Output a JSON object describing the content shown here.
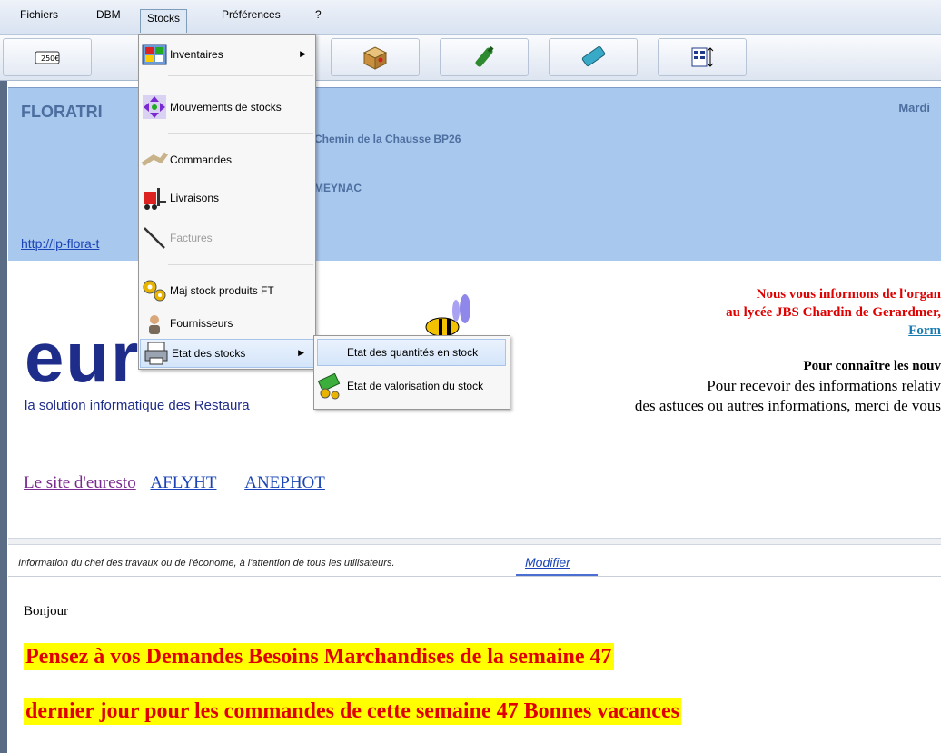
{
  "menubar": {
    "items": [
      "Fichiers",
      "DBM",
      "Stocks",
      "Préférences",
      "?"
    ]
  },
  "toolbar": {
    "buttons": [
      "price-tag-icon",
      "inventory-icon",
      "box-icon",
      "bottle-icon",
      "keyboard-icon",
      "columns-icon"
    ]
  },
  "header": {
    "school": "FLORATRI",
    "address1": "Chemin de la Chausse BP26",
    "city": "MEYNAC",
    "date": "Mardi",
    "url": "http://lp-flora-t"
  },
  "logo": {
    "text": "eur",
    "tagline": "la solution informatique des Restaura"
  },
  "links": [
    "Le site d'euresto",
    "AFLYHT",
    "ANEPHOT"
  ],
  "announce": {
    "line1": "Nous vous informons de l'organ",
    "line2": "au lycée JBS Chardin de Gerardmer,",
    "line3": "Form",
    "line4": "Pour connaître les nouv",
    "line5": "Pour recevoir des informations relativ",
    "line6": "des astuces ou autres informations, merci de vous"
  },
  "info": {
    "label": "Information du chef des travaux ou de l'économe, à l'attention de tous les utilisateurs.",
    "modify": "Modifier",
    "greeting": "Bonjour",
    "msg1": "Pensez à vos Demandes Besoins Marchandises de la semaine 47",
    "msg2": "dernier jour pour les commandes de cette semaine 47 Bonnes vacances"
  },
  "stocks_menu": {
    "items": [
      {
        "label": "Inventaires",
        "submenu": true,
        "enabled": true
      },
      {
        "label": "Mouvements de stocks",
        "submenu": false,
        "enabled": true
      },
      {
        "label": "Commandes",
        "submenu": false,
        "enabled": true
      },
      {
        "label": "Livraisons",
        "submenu": false,
        "enabled": true
      },
      {
        "label": "Factures",
        "submenu": false,
        "enabled": false
      },
      {
        "label": "Maj stock produits FT",
        "submenu": false,
        "enabled": true
      },
      {
        "label": "Fournisseurs",
        "submenu": false,
        "enabled": true
      },
      {
        "label": "Etat des stocks",
        "submenu": true,
        "enabled": true
      }
    ]
  },
  "etat_submenu": {
    "items": [
      "Etat des quantités en stock",
      "Etat de valorisation du stock"
    ]
  },
  "colors": {
    "accent_blue": "#a9c8ee",
    "highlight_yellow": "#ffff00",
    "alert_red": "#e00000"
  }
}
